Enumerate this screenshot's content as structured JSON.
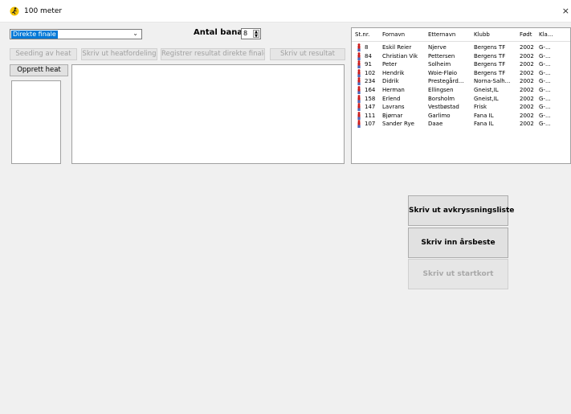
{
  "window": {
    "title": "100 meter",
    "close_glyph": "×",
    "icon": "runner-app-icon"
  },
  "event_select": {
    "value": "Direkte finale",
    "arrow": "⌄"
  },
  "lanes": {
    "label": "Antal banar:",
    "value": "8"
  },
  "toolbar": {
    "seeding": "Seeding av heat",
    "print_heats": "Skriv ut heatfordeling",
    "register_results": "Registrer resultat direkte finale",
    "print_results": "Skriv ut resultat"
  },
  "create_heat": "Opprett heat",
  "participants": {
    "headers": [
      "St.nr.",
      "Fornavn",
      "Etternavn",
      "Klubb",
      "Født",
      "Kla..."
    ],
    "rows": [
      {
        "nr": "8",
        "first": "Eskil Reier",
        "last": "Njerve",
        "club": "Bergens TF",
        "born": "2002",
        "cls": "G-..."
      },
      {
        "nr": "84",
        "first": "Christian Vik",
        "last": "Pettersen",
        "club": "Bergens TF",
        "born": "2002",
        "cls": "G-..."
      },
      {
        "nr": "91",
        "first": "Peter",
        "last": "Solheim",
        "club": "Bergens TF",
        "born": "2002",
        "cls": "G-..."
      },
      {
        "nr": "102",
        "first": "Hendrik",
        "last": "Woie-Fløio",
        "club": "Bergens TF",
        "born": "2002",
        "cls": "G-..."
      },
      {
        "nr": "234",
        "first": "Didrik",
        "last": "Prestegård...",
        "club": "Norna-Salh...",
        "born": "2002",
        "cls": "G-..."
      },
      {
        "nr": "164",
        "first": "Herman",
        "last": "Ellingsen",
        "club": "Gneist,IL",
        "born": "2002",
        "cls": "G-..."
      },
      {
        "nr": "158",
        "first": "Erlend",
        "last": "Borsholm",
        "club": "Gneist,IL",
        "born": "2002",
        "cls": "G-..."
      },
      {
        "nr": "147",
        "first": "Lavrans",
        "last": "Vestbøstad",
        "club": "Frisk",
        "born": "2002",
        "cls": "G-..."
      },
      {
        "nr": "111",
        "first": "Bjørnar",
        "last": "Garlimo",
        "club": "Fana IL",
        "born": "2002",
        "cls": "G-..."
      },
      {
        "nr": "107",
        "first": "Sander Rye",
        "last": "Daae",
        "club": "Fana IL",
        "born": "2002",
        "cls": "G-..."
      }
    ]
  },
  "actions": {
    "print_checklist": "Skriv ut avkryssningsliste",
    "enter_season_best": "Skriv inn årsbeste",
    "print_start_cards": "Skriv ut startkort"
  },
  "colors": {
    "runner_red": "#cc1a1a",
    "runner_blue": "#1e3fa8",
    "selection": "#0078d7",
    "icon_yellow": "#f5c400"
  }
}
